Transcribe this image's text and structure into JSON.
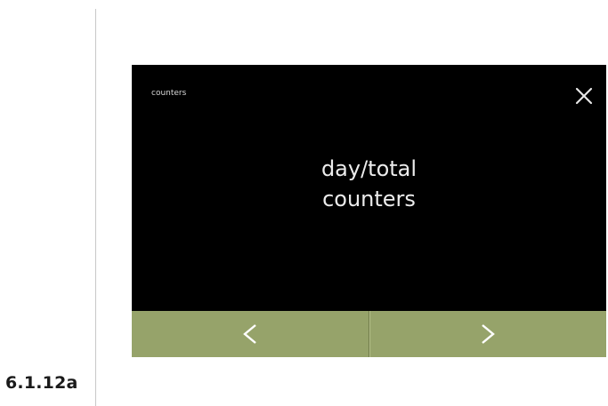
{
  "figure_ref": "6.1.12a",
  "screen": {
    "title": "counters",
    "main_label_lines": [
      "day/total",
      "counters"
    ]
  },
  "icons": {
    "close": "close-icon",
    "prev": "chevron-left-icon",
    "next": "chevron-right-icon"
  },
  "colors": {
    "screen_bg": "#000000",
    "nav_bar": "#96a36a",
    "text": "#ececec"
  }
}
